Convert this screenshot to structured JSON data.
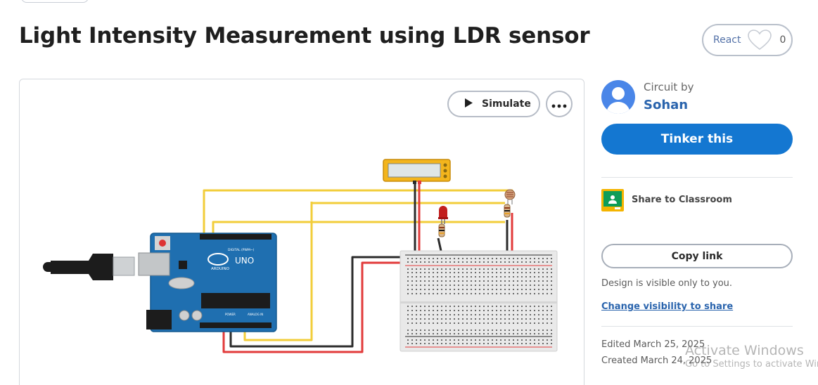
{
  "page": {
    "title": "Light Intensity Measurement using LDR sensor"
  },
  "react": {
    "label": "React",
    "count": "0",
    "icon": "heart-icon"
  },
  "canvas": {
    "simulate_label": "Simulate",
    "simulate_icon": "play-icon",
    "more_icon": "more-dots-icon",
    "components": {
      "arduino_brand": "ARDUINO",
      "arduino_model": "UNO",
      "digital_header": "DIGITAL (PWM~)",
      "power_header": "POWER",
      "analog_header": "ANALOG IN"
    },
    "wire_colors": {
      "yellow": "#f2cd3a",
      "black": "#2b2b2b",
      "red": "#e23b3b"
    }
  },
  "sidebar": {
    "circuit_by": "Circuit by",
    "author": "Sohan",
    "tinker_label": "Tinker this",
    "share_classroom": "Share to Classroom",
    "copy_link": "Copy link",
    "visibility_note": "Design is visible only to you.",
    "visibility_link": "Change visibility to share",
    "edited": "Edited March 25, 2025",
    "created": "Created March 24, 2025"
  },
  "watermark": {
    "title": "Activate Windows",
    "subtitle": "Go to Settings to activate Windows."
  },
  "colors": {
    "accent": "#1477d1",
    "link": "#2a64ad",
    "board": "#1f6fb0"
  }
}
